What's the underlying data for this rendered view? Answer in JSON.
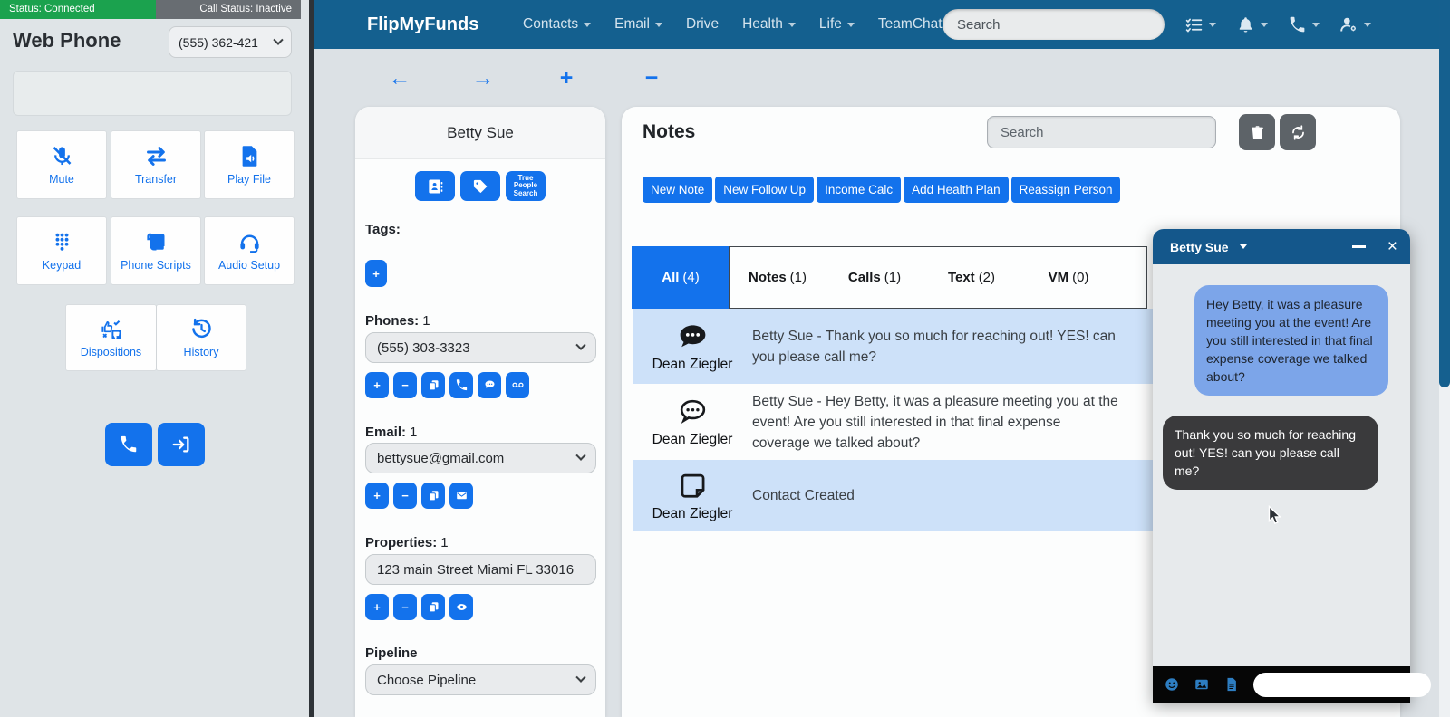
{
  "glyphs": {
    "back": "←",
    "forward": "→",
    "plus": "+",
    "minus": "−",
    "close": "×"
  },
  "webphone": {
    "status_connected": "Status: Connected",
    "status_call": "Call Status: Inactive",
    "title": "Web Phone",
    "number": "(555) 362-421",
    "btn_mute": "Mute",
    "btn_transfer": "Transfer",
    "btn_playfile": "Play File",
    "btn_keypad": "Keypad",
    "btn_scripts": "Phone Scripts",
    "btn_audio": "Audio Setup",
    "btn_dispositions": "Dispositions",
    "btn_history": "History"
  },
  "navbar": {
    "brand": "FlipMyFunds",
    "items": [
      "Contacts",
      "Email",
      "Drive",
      "Health",
      "Life",
      "TeamChat"
    ],
    "search_placeholder": "Search"
  },
  "contact": {
    "name": "Betty Sue",
    "tps_line1": "True",
    "tps_line2": "People",
    "tps_line3": "Search",
    "tags_label": "Tags:",
    "phones_label": "Phones:",
    "phones_count": "1",
    "phone": "(555) 303-3323",
    "email_label": "Email:",
    "email_count": "1",
    "email": "bettysue@gmail.com",
    "properties_label": "Properties:",
    "properties_count": "1",
    "property": "123 main Street Miami FL 33016",
    "pipeline_label": "Pipeline",
    "pipeline_placeholder": "Choose Pipeline"
  },
  "notes": {
    "title": "Notes",
    "search_placeholder": "Search",
    "actions": [
      "New Note",
      "New Follow Up",
      "Income Calc",
      "Add Health Plan",
      "Reassign Person"
    ],
    "tabs": [
      {
        "label": "All",
        "count": "(4)"
      },
      {
        "label": "Notes",
        "count": "(1)"
      },
      {
        "label": "Calls",
        "count": "(1)"
      },
      {
        "label": "Text",
        "count": "(2)"
      },
      {
        "label": "VM",
        "count": "(0)"
      }
    ],
    "rows": [
      {
        "author": "Dean Ziegler",
        "text": "Betty Sue - Thank you so much for reaching out! YES! can you please call me?"
      },
      {
        "author": "Dean Ziegler",
        "text": "Betty Sue - Hey Betty, it was a pleasure meeting you at the event!  Are you still interested in that final expense coverage we talked about?"
      },
      {
        "author": "Dean Ziegler",
        "text": "Contact Created"
      }
    ]
  },
  "chat": {
    "title": "Betty Sue",
    "messages": [
      {
        "text": "Hey Betty, it was a pleasure meeting you at the event!  Are you still interested in that final expense coverage we talked about?"
      },
      {
        "text": "Thank you so much for reaching out! YES! can you please call me?"
      }
    ]
  },
  "colors": {
    "navbar": "#14608f",
    "primary": "#1372ec",
    "row_highlight": "#cde1f9",
    "bubble_blue": "#7ca5e9",
    "bubble_dark": "#3a3a3c",
    "status_green": "#1ba24e",
    "status_gray": "#686d72"
  }
}
